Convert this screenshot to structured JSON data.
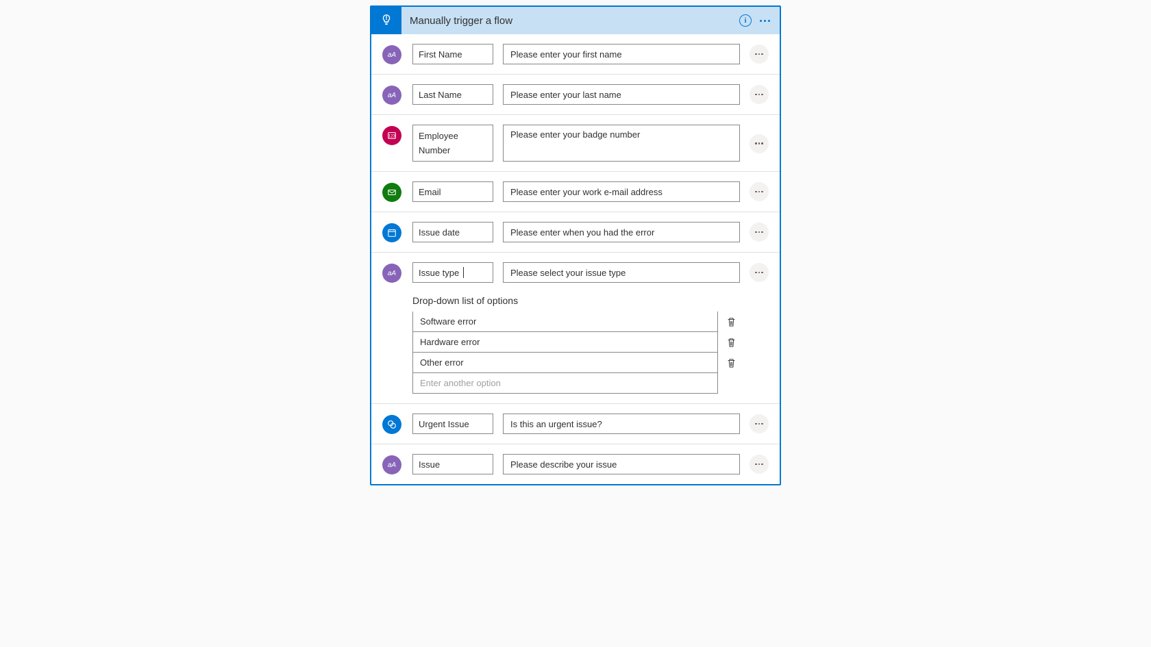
{
  "header": {
    "title": "Manually trigger a flow"
  },
  "inputs": [
    {
      "label": "First Name",
      "desc": "Please enter your first name",
      "type": "text"
    },
    {
      "label": "Last Name",
      "desc": "Please enter your last name",
      "type": "text"
    },
    {
      "label": "Employee Number",
      "desc": "Please enter your badge number",
      "type": "number"
    },
    {
      "label": "Email",
      "desc": "Please enter your work e-mail address",
      "type": "email"
    },
    {
      "label": "Issue date",
      "desc": "Please enter when you had the error",
      "type": "date"
    },
    {
      "label": "Issue type",
      "desc": "Please select your issue type",
      "type": "text"
    },
    {
      "label": "Urgent Issue",
      "desc": "Is this an urgent issue?",
      "type": "yesno"
    },
    {
      "label": "Issue",
      "desc": "Please describe your issue",
      "type": "text"
    }
  ],
  "dropdown": {
    "title": "Drop-down list of options",
    "options": [
      "Software error",
      "Hardware error",
      "Other error"
    ],
    "addPlaceholder": "Enter another option"
  }
}
